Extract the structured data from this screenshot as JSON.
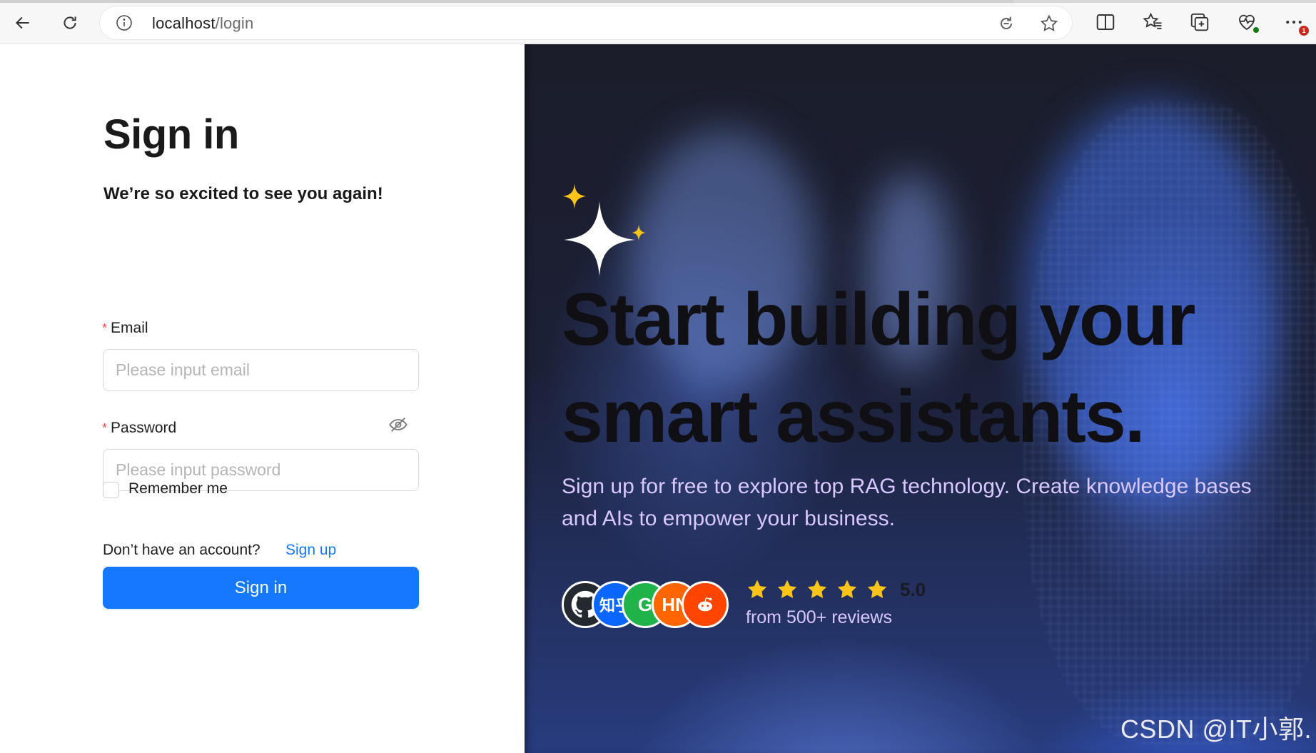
{
  "browser": {
    "url_host": "localhost",
    "url_path": "/login",
    "notification_count": "1"
  },
  "signin": {
    "title": "Sign in",
    "subtitle": "We’re so excited to see you again!",
    "email_label": "Email",
    "email_placeholder": "Please input email",
    "password_label": "Password",
    "password_placeholder": "Please input password",
    "required_mark": "*",
    "remember_label": "Remember me",
    "no_account_text": "Don’t have an account?",
    "signup_link": "Sign up",
    "signin_button": "Sign in"
  },
  "hero": {
    "headline": "Start building your smart assistants.",
    "description": "Sign up for free to explore top RAG technology. Create knowledge bases and AIs to empower your business.",
    "rating_value": "5.0",
    "rating_stars": 5,
    "reviews_text": "from 500+ reviews",
    "avatars": [
      {
        "icon": "github-icon",
        "text": "",
        "color": "#24292f"
      },
      {
        "icon": "zhihu-icon",
        "text": "知乎",
        "color": "#0a66ff"
      },
      {
        "icon": "wechat-icon",
        "text": "G",
        "color": "#1fb34a"
      },
      {
        "icon": "hackernews-icon",
        "text": "HN",
        "color": "#ff6600"
      },
      {
        "icon": "reddit-icon",
        "text": "",
        "color": "#ff4500"
      }
    ],
    "watermark": "CSDN @IT小郭."
  },
  "colors": {
    "primary": "#1677ff",
    "required": "#ff4d4f",
    "star": "#fcc419",
    "hero_text_accent": "#d9c8ff"
  }
}
